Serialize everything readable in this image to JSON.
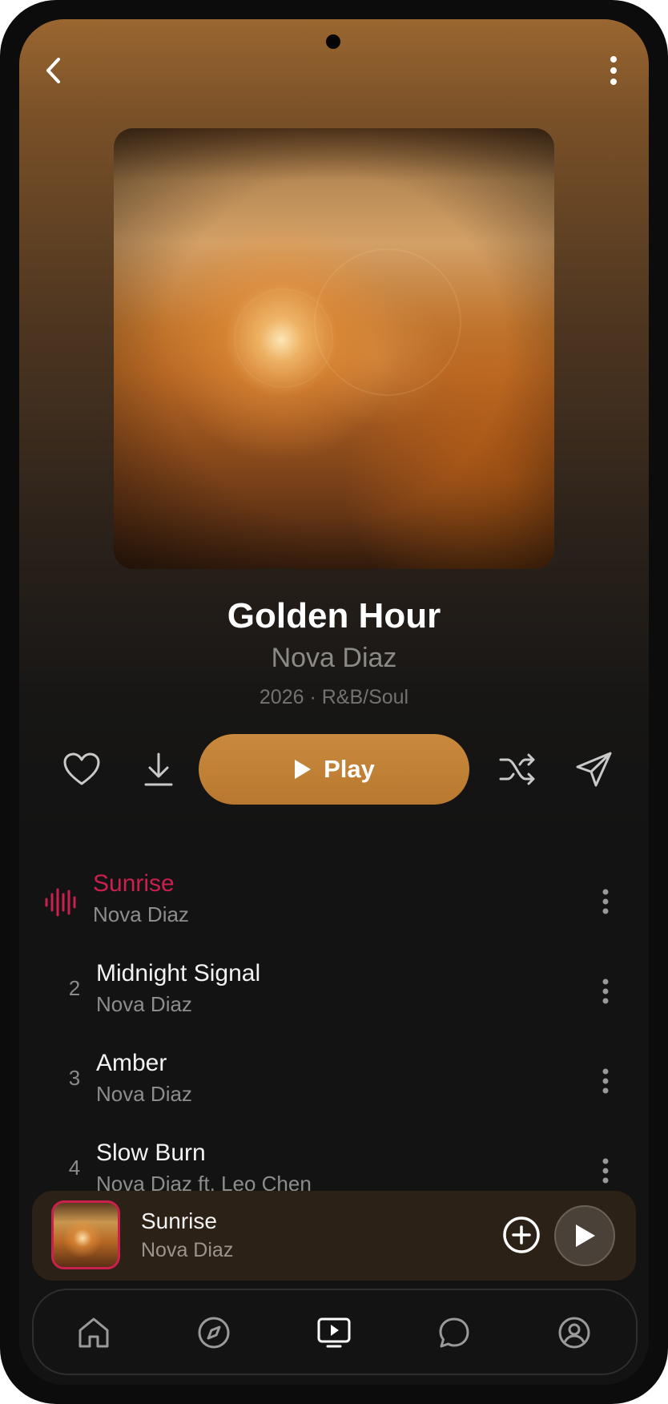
{
  "header": {
    "back_icon": "chevron-left-icon",
    "more_icon": "vertical-dots-icon"
  },
  "album": {
    "title": "Golden Hour",
    "artist": "Nova Diaz",
    "meta": "2026 · R&B/Soul"
  },
  "actions": {
    "like_icon": "heart-icon",
    "download_icon": "download-icon",
    "play_label": "Play",
    "shuffle_icon": "shuffle-icon",
    "share_icon": "send-icon"
  },
  "tracks": [
    {
      "number": "",
      "title": "Sunrise",
      "artist": "Nova Diaz",
      "playing": true
    },
    {
      "number": "2",
      "title": "Midnight Signal",
      "artist": "Nova Diaz",
      "playing": false
    },
    {
      "number": "3",
      "title": "Amber",
      "artist": "Nova Diaz",
      "playing": false
    },
    {
      "number": "4",
      "title": "Slow Burn",
      "artist": "Nova Diaz ft. Leo Chen",
      "playing": false
    }
  ],
  "mini_player": {
    "title": "Sunrise",
    "artist": "Nova Diaz"
  },
  "bottom_nav": [
    "home-icon",
    "compass-icon",
    "video-icon",
    "chat-icon",
    "profile-icon"
  ],
  "colors": {
    "accent": "#c98a3e",
    "playing": "#c9204d",
    "background": "#131313"
  }
}
